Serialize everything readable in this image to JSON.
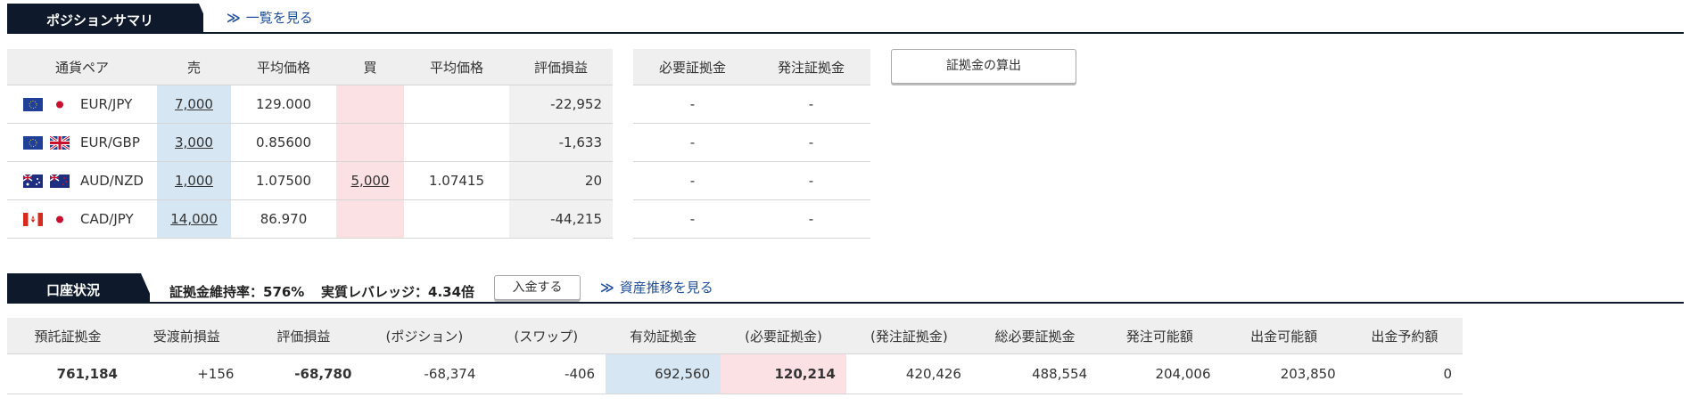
{
  "position_summary": {
    "title": "ポジションサマリ",
    "list_link": "一覧を見る",
    "columns": [
      "通貨ペア",
      "売",
      "平均価格",
      "買",
      "平均価格",
      "評価損益"
    ],
    "rows": [
      {
        "flag1": "eu-flag-icon",
        "flag2": "jp-flag-icon",
        "pair": "EUR/JPY",
        "sell": "7,000",
        "sell_avg": "129.000",
        "buy": "",
        "buy_avg": "",
        "pl": "-22,952"
      },
      {
        "flag1": "eu-flag-icon",
        "flag2": "uk-flag-icon",
        "pair": "EUR/GBP",
        "sell": "3,000",
        "sell_avg": "0.85600",
        "buy": "",
        "buy_avg": "",
        "pl": "-1,633"
      },
      {
        "flag1": "au-flag-icon",
        "flag2": "nz-flag-icon",
        "pair": "AUD/NZD",
        "sell": "1,000",
        "sell_avg": "1.07500",
        "buy": "5,000",
        "buy_avg": "1.07415",
        "pl": "20"
      },
      {
        "flag1": "ca-flag-icon",
        "flag2": "jp-flag-icon",
        "pair": "CAD/JPY",
        "sell": "14,000",
        "sell_avg": "86.970",
        "buy": "",
        "buy_avg": "",
        "pl": "-44,215"
      }
    ],
    "margin_columns": [
      "必要証拠金",
      "発注証拠金"
    ],
    "margin_rows": [
      [
        "-",
        "-"
      ],
      [
        "-",
        "-"
      ],
      [
        "-",
        "-"
      ],
      [
        "-",
        "-"
      ]
    ],
    "calc_button": "証拠金の算出"
  },
  "account": {
    "title": "口座状況",
    "maintenance_rate": "証拠金維持率：576%",
    "leverage": "実質レバレッジ：4.34倍",
    "deposit_button": "入金する",
    "history_link": "資産推移を見る",
    "columns": [
      "預託証拠金",
      "受渡前損益",
      "評価損益",
      "(ポジション)",
      "(スワップ)",
      "有効証拠金",
      "(必要証拠金)",
      "(発注証拠金)",
      "総必要証拠金",
      "発注可能額",
      "出金可能額",
      "出金予約額"
    ],
    "values": [
      "761,184",
      "+156",
      "-68,780",
      "-68,374",
      "-406",
      "692,560",
      "120,214",
      "420,426",
      "488,554",
      "204,006",
      "203,850",
      "0"
    ]
  },
  "colors": {
    "header_bg": "#0e1a2b",
    "link": "#1f4e9a",
    "sell_bg": "#d6e6f3",
    "buy_bg": "#fbe1e4"
  }
}
